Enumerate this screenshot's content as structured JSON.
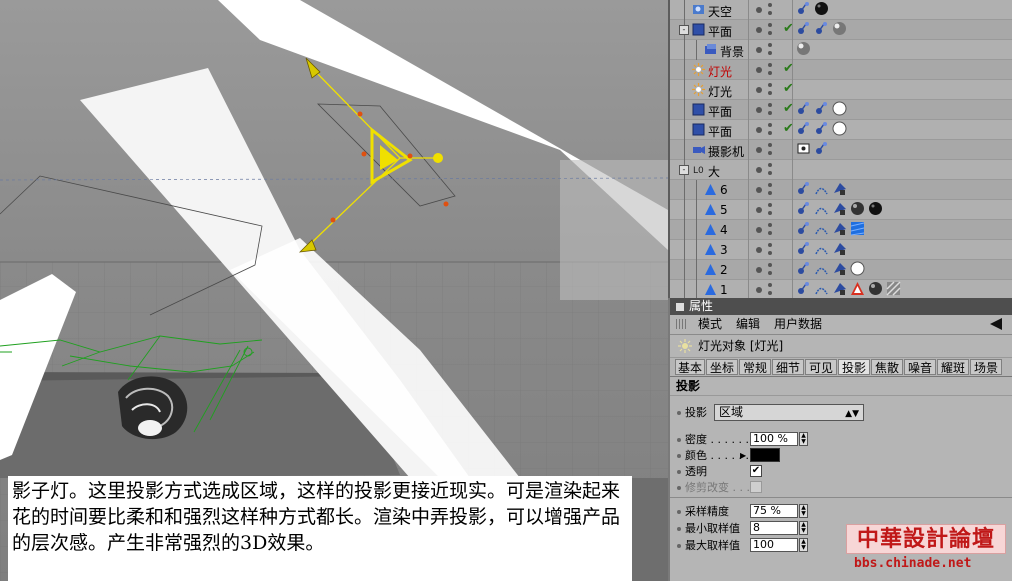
{
  "object_manager": {
    "rows": [
      {
        "name": "天空",
        "indent": 1,
        "active": false,
        "icon": "sky-icon",
        "check": false,
        "tags": [
          "texture-tag",
          "material-ball-black"
        ]
      },
      {
        "name": "平面",
        "indent": 1,
        "active": false,
        "icon": "plane-icon",
        "check": true,
        "expander": "-",
        "tags": [
          "texture-tag",
          "texture-tag",
          "material-ball-gray"
        ]
      },
      {
        "name": "背景",
        "indent": 2,
        "active": false,
        "icon": "background-icon",
        "check": false,
        "tags": [
          "material-ball-gray"
        ]
      },
      {
        "name": "灯光",
        "indent": 1,
        "active": true,
        "icon": "light-icon",
        "check": true,
        "tags": []
      },
      {
        "name": "灯光",
        "indent": 1,
        "active": false,
        "icon": "light-icon",
        "check": true,
        "tags": []
      },
      {
        "name": "平面",
        "indent": 1,
        "active": false,
        "icon": "plane-icon",
        "check": true,
        "tags": [
          "texture-tag",
          "texture-tag",
          "material-ball-white"
        ]
      },
      {
        "name": "平面",
        "indent": 1,
        "active": false,
        "icon": "plane-icon",
        "check": true,
        "tags": [
          "texture-tag",
          "texture-tag",
          "material-ball-white"
        ]
      },
      {
        "name": "摄影机",
        "indent": 1,
        "active": false,
        "icon": "camera-icon",
        "check": false,
        "tags": [
          "camera-tag",
          "texture-tag"
        ]
      },
      {
        "name": "大",
        "indent": 1,
        "active": false,
        "icon": "null-icon",
        "check": false,
        "expander": "-",
        "tags": []
      },
      {
        "name": "6",
        "indent": 2,
        "active": false,
        "icon": "polygon-icon",
        "check": false,
        "tags": [
          "texture-tag",
          "phong-tag",
          "compositing-tag"
        ]
      },
      {
        "name": "5",
        "indent": 2,
        "active": false,
        "icon": "polygon-icon",
        "check": false,
        "tags": [
          "texture-tag",
          "phong-tag",
          "compositing-tag",
          "material-ball-dark",
          "material-ball-black"
        ]
      },
      {
        "name": "4",
        "indent": 2,
        "active": false,
        "icon": "polygon-icon",
        "check": false,
        "tags": [
          "texture-tag",
          "phong-tag",
          "compositing-tag",
          "material-blue"
        ]
      },
      {
        "name": "3",
        "indent": 2,
        "active": false,
        "icon": "polygon-icon",
        "check": false,
        "tags": [
          "texture-tag",
          "phong-tag",
          "compositing-tag"
        ]
      },
      {
        "name": "2",
        "indent": 2,
        "active": false,
        "icon": "polygon-icon",
        "check": false,
        "tags": [
          "texture-tag",
          "phong-tag",
          "compositing-tag",
          "material-ball-white"
        ]
      },
      {
        "name": "1",
        "indent": 2,
        "active": false,
        "icon": "polygon-icon",
        "check": false,
        "tags": [
          "texture-tag",
          "phong-tag",
          "compositing-tag",
          "warning-tag",
          "material-ball-dark",
          "material-stripe"
        ]
      }
    ]
  },
  "attributes": {
    "panel_title": "属性",
    "menu": {
      "mode": "模式",
      "edit": "编辑",
      "user_data": "用户数据"
    },
    "object_header": "灯光对象 [灯光]",
    "tabs": [
      "基本",
      "坐标",
      "常规",
      "细节",
      "可见",
      "投影",
      "焦散",
      "噪音",
      "耀斑",
      "场景"
    ],
    "active_tab": "投影",
    "section_title": "投影",
    "shadow": {
      "label": "投影",
      "value": "区域"
    },
    "density": {
      "label": "密度",
      "value": "100 %"
    },
    "color": {
      "label": "颜色",
      "value": "#000000"
    },
    "transparency": {
      "label": "透明",
      "checked": true
    },
    "clip_change": {
      "label": "修剪改变",
      "checked": false
    },
    "sample_accuracy": {
      "label": "采样精度",
      "value": "75 %"
    },
    "min_samples": {
      "label": "最小取样值",
      "value": "8"
    },
    "max_samples": {
      "label": "最大取样值",
      "value": "100"
    }
  },
  "caption": {
    "text": "影子灯。这里投影方式选成区域，这样的投影更接近现实。可是渲染起来花的时间要比柔和和强烈这样种方式都长。渲染中弄投影，可以增强产品的层次感。产生非常强烈的3D效果。"
  },
  "watermark": {
    "title": "中華設計論壇",
    "url": "bbs.chinade.net"
  },
  "colors": {
    "active_object": "#c00000",
    "light_gizmo": "#f0e000",
    "selection_green": "#1fa01f"
  }
}
